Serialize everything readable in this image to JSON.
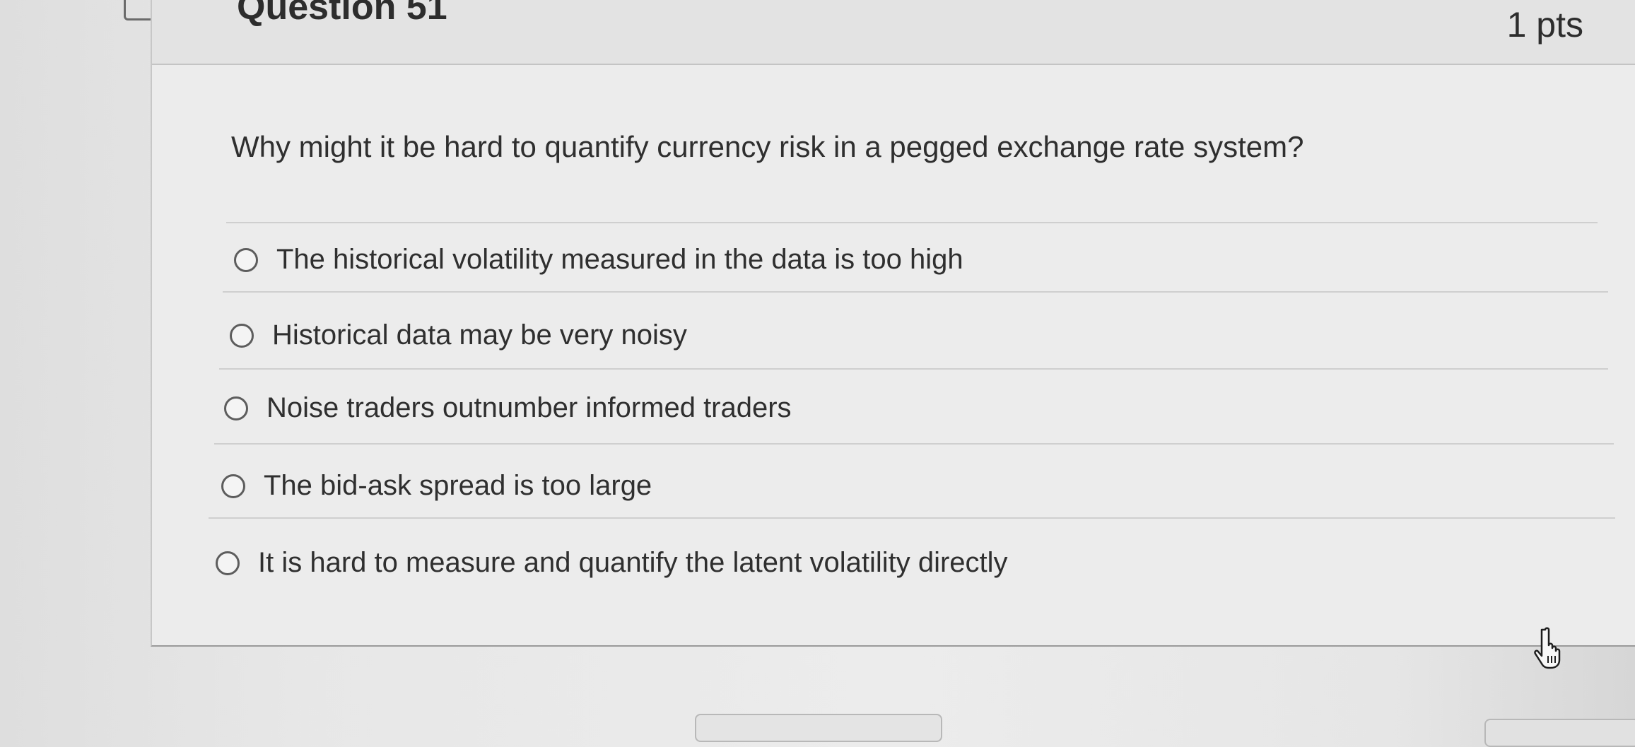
{
  "question": {
    "title": "Question 51",
    "points": "1 pts",
    "prompt": "Why might it be hard to quantify currency risk in a pegged exchange rate system?",
    "options": [
      {
        "label": "The historical volatility measured in the data is too high",
        "selected": false
      },
      {
        "label": "Historical data may be very noisy",
        "selected": false
      },
      {
        "label": "Noise traders outnumber informed traders",
        "selected": false
      },
      {
        "label": "The bid-ask spread is too large",
        "selected": false
      },
      {
        "label": "It is hard to measure and quantify the latent volatility directly",
        "selected": false
      }
    ]
  },
  "icons": {
    "flag": "flag-tab-icon",
    "cursor": "hand-cursor-icon"
  },
  "colors": {
    "background": "#e9e9e9",
    "header": "#e3e3e3",
    "text": "#2f2f2f",
    "border": "#c4c4c4"
  }
}
